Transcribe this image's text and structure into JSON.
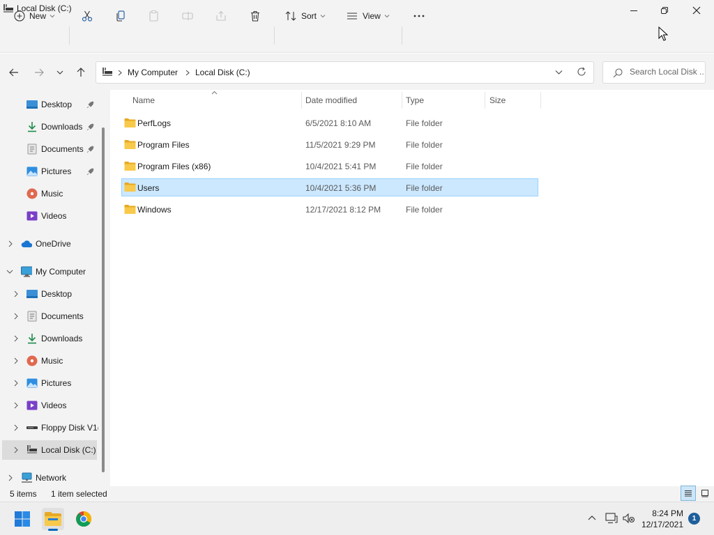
{
  "window": {
    "title": "Local Disk (C:)"
  },
  "toolbar": {
    "new_label": "New",
    "sort_label": "Sort",
    "view_label": "View"
  },
  "address": {
    "crumbs": [
      "My Computer",
      "Local Disk (C:)"
    ],
    "search_placeholder": "Search Local Disk ..."
  },
  "nav": {
    "quick_access": [
      {
        "label": "Desktop",
        "icon": "desktop-icon",
        "pinned": true
      },
      {
        "label": "Downloads",
        "icon": "download-icon",
        "pinned": true
      },
      {
        "label": "Documents",
        "icon": "document-icon",
        "pinned": true
      },
      {
        "label": "Pictures",
        "icon": "pictures-icon",
        "pinned": true
      },
      {
        "label": "Music",
        "icon": "music-icon",
        "pinned": false
      },
      {
        "label": "Videos",
        "icon": "videos-icon",
        "pinned": false
      }
    ],
    "onedrive": "OneDrive",
    "computer": "My Computer",
    "computer_children": [
      {
        "label": "Desktop",
        "icon": "desktop-icon"
      },
      {
        "label": "Documents",
        "icon": "document-icon"
      },
      {
        "label": "Downloads",
        "icon": "download-icon"
      },
      {
        "label": "Music",
        "icon": "music-icon"
      },
      {
        "label": "Pictures",
        "icon": "pictures-icon"
      },
      {
        "label": "Videos",
        "icon": "videos-icon"
      },
      {
        "label": "Floppy Disk V1(",
        "icon": "floppy-icon"
      },
      {
        "label": "Local Disk (C:)",
        "icon": "drive-icon",
        "selected": true
      }
    ],
    "network": "Network"
  },
  "columns": {
    "name": "Name",
    "date": "Date modified",
    "type": "Type",
    "size": "Size"
  },
  "files": [
    {
      "name": "PerfLogs",
      "date": "6/5/2021 8:10 AM",
      "type": "File folder",
      "selected": false
    },
    {
      "name": "Program Files",
      "date": "11/5/2021 9:29 PM",
      "type": "File folder",
      "selected": false
    },
    {
      "name": "Program Files (x86)",
      "date": "10/4/2021 5:41 PM",
      "type": "File folder",
      "selected": false
    },
    {
      "name": "Users",
      "date": "10/4/2021 5:36 PM",
      "type": "File folder",
      "selected": true
    },
    {
      "name": "Windows",
      "date": "12/17/2021 8:12 PM",
      "type": "File folder",
      "selected": false
    }
  ],
  "status": {
    "count": "5 items",
    "selection": "1 item selected"
  },
  "taskbar": {
    "time": "8:24 PM",
    "date": "12/17/2021",
    "notifications": "1"
  },
  "colors": {
    "accent": "#0067c0",
    "selection": "#cce8ff",
    "folder": "#f8c94a"
  }
}
